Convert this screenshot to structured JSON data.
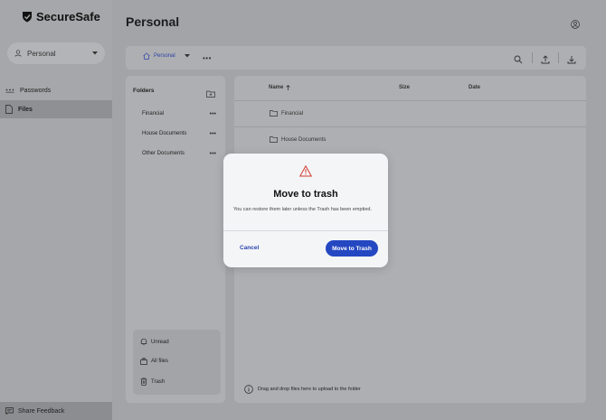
{
  "brand": {
    "name": "SecureSafe"
  },
  "account": {
    "label": "Personal"
  },
  "nav": {
    "items": [
      {
        "label": "Passwords"
      },
      {
        "label": "Files"
      }
    ]
  },
  "footer": {
    "feedback_label": "Share Feedback"
  },
  "page": {
    "title": "Personal"
  },
  "breadcrumb": {
    "label": "Personal"
  },
  "folders": {
    "title": "Folders",
    "items": [
      {
        "label": "Financial"
      },
      {
        "label": "House Documents"
      },
      {
        "label": "Other Documents"
      }
    ],
    "quick": [
      {
        "label": "Unread"
      },
      {
        "label": "All files"
      },
      {
        "label": "Trash"
      }
    ]
  },
  "files": {
    "columns": {
      "name": "Name",
      "size": "Size",
      "date": "Date"
    },
    "rows": [
      {
        "name": "Financial"
      },
      {
        "name": "House Documents"
      }
    ],
    "hint": "Drag and drop files here to upload to the folder"
  },
  "modal": {
    "title": "Move to trash",
    "body": "You can restore them later unless the Trash has been emptied.",
    "cancel_label": "Cancel",
    "confirm_label": "Move to Trash"
  },
  "colors": {
    "accent": "#2447c2",
    "warning": "#d03a2e"
  }
}
